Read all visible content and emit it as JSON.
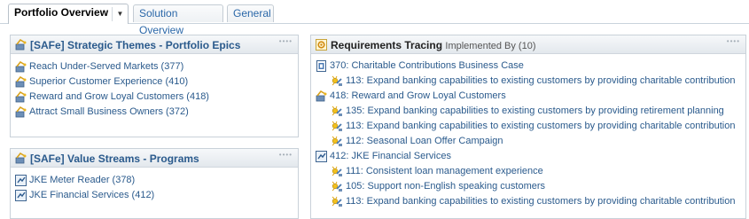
{
  "tabs": [
    {
      "label": "Portfolio Overview"
    },
    {
      "label": "Solution Overview"
    },
    {
      "label": "General"
    }
  ],
  "tab_menu_icon": "chevron-down-icon",
  "themes_panel": {
    "title": "[SAFe] Strategic Themes - Portfolio Epics",
    "items": [
      {
        "label": "Reach Under-Served Markets (377)",
        "icon": "portfolio-epic-icon"
      },
      {
        "label": "Superior Customer Experience (410)",
        "icon": "portfolio-epic-icon"
      },
      {
        "label": "Reward and Grow Loyal Customers (418)",
        "icon": "portfolio-epic-icon"
      },
      {
        "label": "Attract Small Business Owners (372)",
        "icon": "portfolio-epic-icon"
      }
    ]
  },
  "streams_panel": {
    "title": "[SAFe] Value Streams - Programs",
    "items": [
      {
        "label": "JKE Meter Reader (378)",
        "icon": "program-icon"
      },
      {
        "label": "JKE Financial Services (412)",
        "icon": "program-icon"
      }
    ]
  },
  "tracing_panel": {
    "title": "Requirements Tracing",
    "subtitle": "Implemented By (10)",
    "rows": [
      {
        "label": "370: Charitable Contributions Business Case",
        "level": 0,
        "icon": "business-case-icon"
      },
      {
        "label": "113: Expand banking capabilities to existing customers by providing charitable contribution",
        "level": 1,
        "icon": "feature-icon"
      },
      {
        "label": "418: Reward and Grow Loyal Customers",
        "level": 0,
        "icon": "portfolio-epic-icon"
      },
      {
        "label": "135: Expand banking capabilities to existing customers by providing retirement planning",
        "level": 1,
        "icon": "feature-icon"
      },
      {
        "label": "113: Expand banking capabilities to existing customers by providing charitable contribution",
        "level": 1,
        "icon": "feature-icon"
      },
      {
        "label": "112: Seasonal Loan Offer Campaign",
        "level": 1,
        "icon": "feature-icon"
      },
      {
        "label": "412: JKE Financial Services",
        "level": 0,
        "icon": "program-icon"
      },
      {
        "label": "111: Consistent loan management experience",
        "level": 1,
        "icon": "feature-icon"
      },
      {
        "label": "105: Support non-English speaking customers",
        "level": 1,
        "icon": "feature-icon"
      },
      {
        "label": "113: Expand banking capabilities to existing customers by providing charitable contribution",
        "level": 1,
        "icon": "feature-icon"
      }
    ]
  }
}
